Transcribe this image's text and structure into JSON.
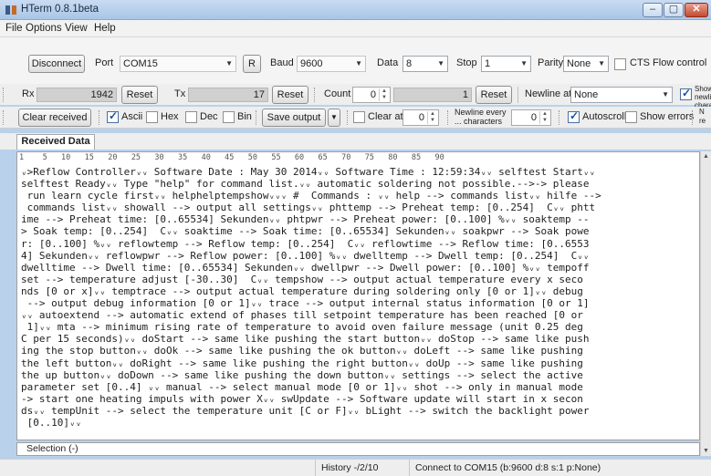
{
  "window": {
    "title": "HTerm 0.8.1beta",
    "minimize": "–",
    "maximize": "▢",
    "close": "✕"
  },
  "menu": [
    "File",
    "Options",
    "View",
    "Help"
  ],
  "connection": {
    "disconnect_label": "Disconnect",
    "port_label": "Port",
    "port_value": "COM15",
    "refresh_label": "R",
    "baud_label": "Baud",
    "baud_value": "9600",
    "data_label": "Data",
    "data_value": "8",
    "stop_label": "Stop",
    "stop_value": "1",
    "parity_label": "Parity",
    "parity_value": "None",
    "cts_label": "CTS Flow control",
    "cts_checked": false
  },
  "counters": {
    "rx_label": "Rx",
    "rx_value": "1942",
    "rx_reset": "Reset",
    "tx_label": "Tx",
    "tx_value": "17",
    "tx_reset": "Reset",
    "count_label": "Count",
    "count_value": "0",
    "count_display": "1",
    "count_reset": "Reset",
    "newline_label": "Newline at",
    "newline_value": "None",
    "show_chars_label": "Show newline characters",
    "show_chars_checked": true
  },
  "receive_toolbar": {
    "clear_received": "Clear received",
    "ascii_label": "Ascii",
    "ascii_checked": true,
    "hex_label": "Hex",
    "hex_checked": false,
    "dec_label": "Dec",
    "dec_checked": false,
    "bin_label": "Bin",
    "bin_checked": false,
    "save_output": "Save output",
    "clear_at_label": "Clear at",
    "clear_at_value": "0",
    "newline_every_label": "Newline every ... characters",
    "newline_every_value": "0",
    "autoscroll_label": "Autoscroll",
    "autoscroll_checked": true,
    "show_errors_label": "Show errors",
    "show_errors_checked": false,
    "trailing_label": "N re"
  },
  "tabs": {
    "received_data": "Received Data"
  },
  "ruler": "1    5   10   15   20   25   30   35   40   45   50   55   60   65   70   75   80   85   90",
  "received_lines": [
    "ᵥ>Reflow Controllerᵥᵥ Software Date : May 30 2014ᵥᵥ Software Time : 12:59:34ᵥᵥ selftest Startᵥᵥ",
    "selftest Readyᵥᵥ Type \"help\" for command list.ᵥᵥ automatic soldering not possible.-->-> please",
    " run learn cycle firstᵥᵥ helphelptempshowᵥᵥᵥ #  Commands : ᵥᵥ help --> commands listᵥᵥ hilfe -->",
    " commands listᵥᵥ showall --> output all settingsᵥᵥ phttemp --> Preheat temp: [0..254]  Cᵥᵥ phtt",
    "ime --> Preheat time: [0..65534] Sekundenᵥᵥ phtpwr --> Preheat power: [0..100] %ᵥᵥ soaktemp --",
    "> Soak temp: [0..254]  Cᵥᵥ soaktime --> Soak time: [0..65534] Sekundenᵥᵥ soakpwr --> Soak powe",
    "r: [0..100] %ᵥᵥ reflowtemp --> Reflow temp: [0..254]  Cᵥᵥ reflowtime --> Reflow time: [0..6553",
    "4] Sekundenᵥᵥ reflowpwr --> Reflow power: [0..100] %ᵥᵥ dwelltemp --> Dwell temp: [0..254]  Cᵥᵥ",
    "dwelltime --> Dwell time: [0..65534] Sekundenᵥᵥ dwellpwr --> Dwell power: [0..100] %ᵥᵥ tempoff",
    "set --> temperature adjust [-30..30]  Cᵥᵥ tempshow --> output actual temperature every x seco",
    "nds [0 or x]ᵥᵥ temptrace --> output actual temperature during soldering only [0 or 1]ᵥᵥ debug",
    " --> output debug information [0 or 1]ᵥᵥ trace --> output internal status information [0 or 1]",
    "ᵥᵥ autoextend --> automatic extend of phases till setpoint temperature has been reached [0 or",
    " 1]ᵥᵥ mta --> minimum rising rate of temperature to avoid oven failure message (unit 0.25 deg",
    "C per 15 seconds)ᵥᵥ doStart --> same like pushing the start buttonᵥᵥ doStop --> same like push",
    "ing the stop buttonᵥᵥ doOk --> same like pushing the ok buttonᵥᵥ doLeft --> same like pushing",
    "the left buttonᵥᵥ doRight --> same like pushing the right buttonᵥᵥ doUp --> same like pushing",
    "the up buttonᵥᵥ doDown --> same like pushing the down buttonᵥᵥ settings --> select the active",
    "parameter set [0..4] ᵥᵥ manual --> select manual mode [0 or 1]ᵥᵥ shot --> only in manual mode",
    "-> start one heating impuls with power Xᵥᵥ swUpdate --> Software update will start in x secon",
    "dsᵥᵥ tempUnit --> select the temperature unit [C or F]ᵥᵥ bLight --> switch the backlight power",
    " [0..10]ᵥᵥ"
  ],
  "selection": "Selection (-)",
  "status": {
    "history": "History -/2/10",
    "connection": "Connect to COM15 (b:9600 d:8 s:1 p:None)"
  },
  "colors": {
    "accent": "#1b4fa0",
    "window_frame": "#b9d1ea",
    "close": "#c44a2e"
  }
}
